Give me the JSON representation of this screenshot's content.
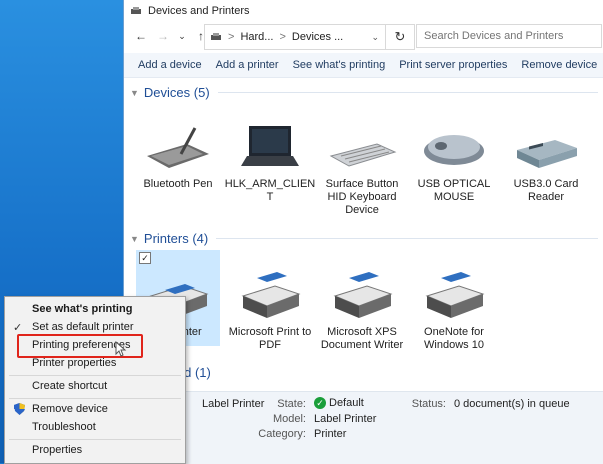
{
  "window": {
    "title": "Devices and Printers"
  },
  "nav": {
    "back": "←",
    "forward": "→",
    "recent": "⌄",
    "up": "↑"
  },
  "address": {
    "seg1": "Hard...",
    "sep": ">",
    "seg2": "Devices ...",
    "drop": "⌄",
    "refresh": "↻"
  },
  "search": {
    "placeholder": "Search Devices and Printers"
  },
  "commands": [
    "Add a device",
    "Add a printer",
    "See what's printing",
    "Print server properties",
    "Remove device"
  ],
  "devices": {
    "header": "Devices (5)",
    "items": [
      {
        "label": "Bluetooth Pen",
        "icon": "pen-tablet-icon"
      },
      {
        "label": "HLK_ARM_CLIEN T",
        "icon": "laptop-icon"
      },
      {
        "label": "Surface Button HID Keyboard Device",
        "icon": "keyboard-icon"
      },
      {
        "label": "USB OPTICAL MOUSE",
        "icon": "mouse-icon"
      },
      {
        "label": "USB3.0 Card Reader",
        "icon": "card-reader-icon"
      }
    ]
  },
  "printers": {
    "header": "Printers (4)",
    "items": [
      {
        "label": "inter",
        "icon": "printer-icon",
        "selected": true,
        "check": "✓"
      },
      {
        "label": "Microsoft Print to PDF",
        "icon": "printer-icon"
      },
      {
        "label": "Microsoft XPS Document Writer",
        "icon": "printer-icon"
      },
      {
        "label": "OneNote for Windows 10",
        "icon": "printer-icon"
      }
    ]
  },
  "unspecified": {
    "header": "ied (1)"
  },
  "details": {
    "name": "Label Printer",
    "state_label": "State:",
    "state_value": "Default",
    "model_label": "Model:",
    "model_value": "Label Printer",
    "category_label": "Category:",
    "category_value": "Printer",
    "status_label": "Status:",
    "status_value": "0 document(s) in queue"
  },
  "context_menu": {
    "items": [
      {
        "label": "See what's printing",
        "bold": true
      },
      {
        "label": "Set as default printer",
        "mark": "✓"
      },
      {
        "label": "Printing preferences",
        "highlighted": true
      },
      {
        "label": "Printer properties"
      },
      {
        "label": "Create shortcut"
      },
      {
        "label": "Remove device",
        "icon": "uac-shield-icon"
      },
      {
        "label": "Troubleshoot"
      },
      {
        "label": "Properties"
      }
    ]
  },
  "colors": {
    "accent": "#1f4e96",
    "selection": "#cce8ff",
    "highlight_border": "#e0241b",
    "ok": "#1a9e3a"
  }
}
